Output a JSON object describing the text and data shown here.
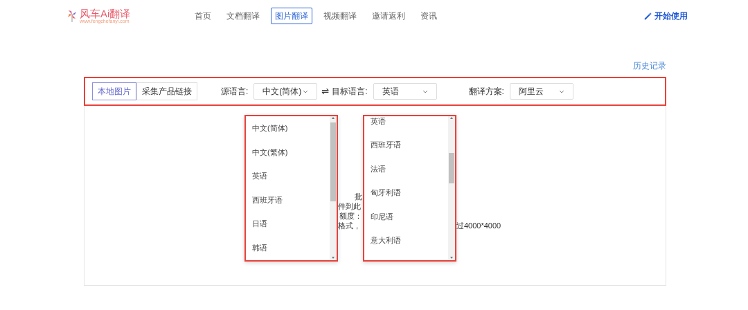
{
  "logo": {
    "name": "风车Ai翻译",
    "tagline": "www.fengchefanyi.com"
  },
  "nav": [
    {
      "label": "首页",
      "selected": false
    },
    {
      "label": "文档翻译",
      "selected": false
    },
    {
      "label": "图片翻译",
      "selected": true
    },
    {
      "label": "视频翻译",
      "selected": false
    },
    {
      "label": "邀请返利",
      "selected": false
    },
    {
      "label": "资讯",
      "selected": false
    }
  ],
  "start_button": "开始使用",
  "history_link": "历史记录",
  "source_tabs": [
    {
      "label": "本地图片",
      "selected": true
    },
    {
      "label": "采集产品链接",
      "selected": false
    }
  ],
  "selects": [
    {
      "label": "源语言:",
      "value": "中文(简体)"
    },
    {
      "label": "目标语言:",
      "value": "英语"
    },
    {
      "label": "翻译方案:",
      "value": "阿里云"
    }
  ],
  "swap_icon": "⇌",
  "source_dropdown": [
    "中文(简体)",
    "中文(繁体)",
    "英语",
    "西班牙语",
    "日语",
    "韩语"
  ],
  "target_dropdown": [
    "英语",
    "西班牙语",
    "法语",
    "匈牙利语",
    "印尼语",
    "意大利语"
  ],
  "hint_fragments": [
    "批",
    "件到此",
    "额度：",
    "格式，"
  ],
  "size_fragment": "过4000*4000"
}
